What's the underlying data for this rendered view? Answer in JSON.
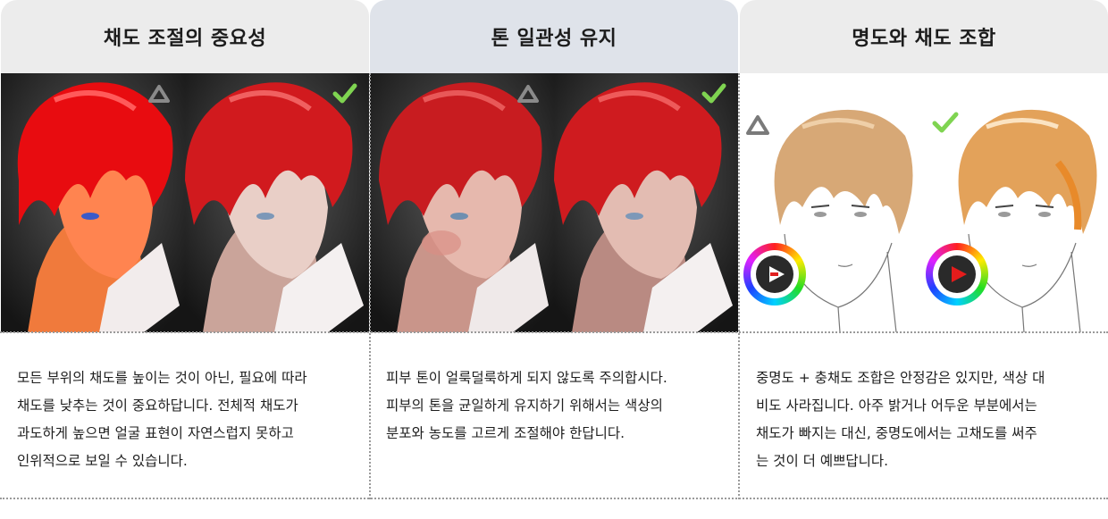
{
  "columns": [
    {
      "title": "채도 조절의 중요성",
      "lines": [
        "모든 부위의 채도를 높이는 것이 아닌, 필요에 따라",
        "채도를 낮추는 것이 중요하답니다. 전체적 채도가",
        "과도하게 높으면 얼굴 표현이 자연스럽지 못하고",
        "인위적으로 보일 수 있습니다."
      ]
    },
    {
      "title": "톤 일관성 유지",
      "lines": [
        "피부 톤이 얼룩덜룩하게 되지 않도록 주의합시다.",
        "피부의 톤을 균일하게 유지하기 위해서는 색상의",
        "분포와 농도를 고르게 조절해야 한답니다."
      ]
    },
    {
      "title": "명도와 채도 조합",
      "lines": [
        "중명도 + 충채도 조합은 안정감은 있지만, 색상 대",
        "비도 사라집니다. 아주 밝거나 어두운 부분에서는",
        "채도가 빠지는 대신, 중명도에서는 고채도를 써주",
        "는 것이 더 예쁘답니다."
      ]
    }
  ],
  "icons": {
    "caution": "triangle-icon",
    "ok": "check-icon",
    "picker": "color-wheel-icon"
  },
  "colors": {
    "check": "#7fd451",
    "triangle_dark": "#8a8a8a",
    "triangle_light": "#7a7a7a",
    "header_gray": "#ececec",
    "header_blue": "#dfe3ea"
  }
}
